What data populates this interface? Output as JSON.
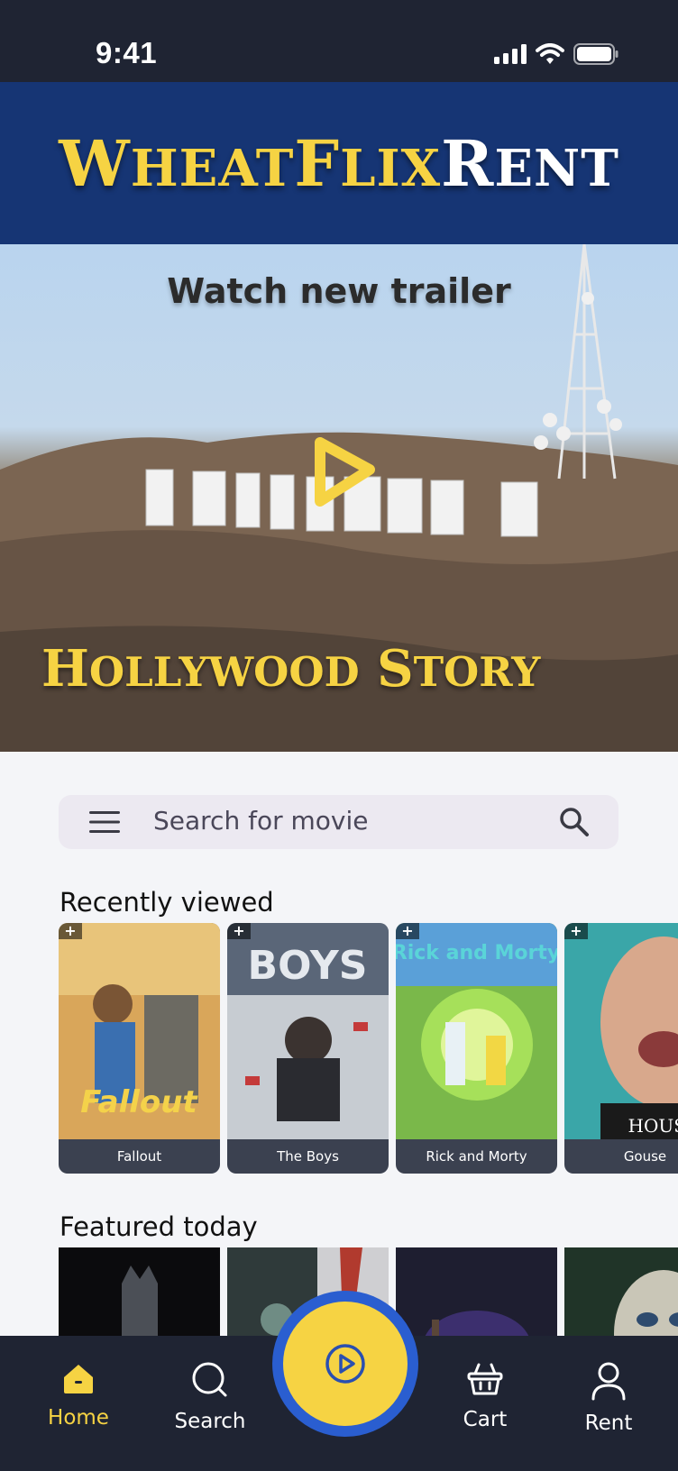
{
  "status_bar": {
    "time": "9:41"
  },
  "header": {
    "brand_yellow": "WheatFlix",
    "brand_white": "Rent"
  },
  "hero": {
    "top_label": "Watch new trailer",
    "title": "Hollywood story"
  },
  "search": {
    "placeholder": "Search for movie"
  },
  "recently_viewed": {
    "title": "Recently viewed",
    "items": [
      {
        "label": "Fallout"
      },
      {
        "label": "The Boys"
      },
      {
        "label": "Rick and Morty"
      },
      {
        "label": "Gouse"
      }
    ]
  },
  "featured": {
    "title": "Featured today"
  },
  "nav": {
    "home": "Home",
    "search": "Search",
    "cart": "Cart",
    "rent": "Rent"
  },
  "colors": {
    "accent": "#f6d343",
    "brand_blue": "#163574",
    "nav_bg": "#1f2433",
    "fab_ring": "#2a5ed0"
  }
}
